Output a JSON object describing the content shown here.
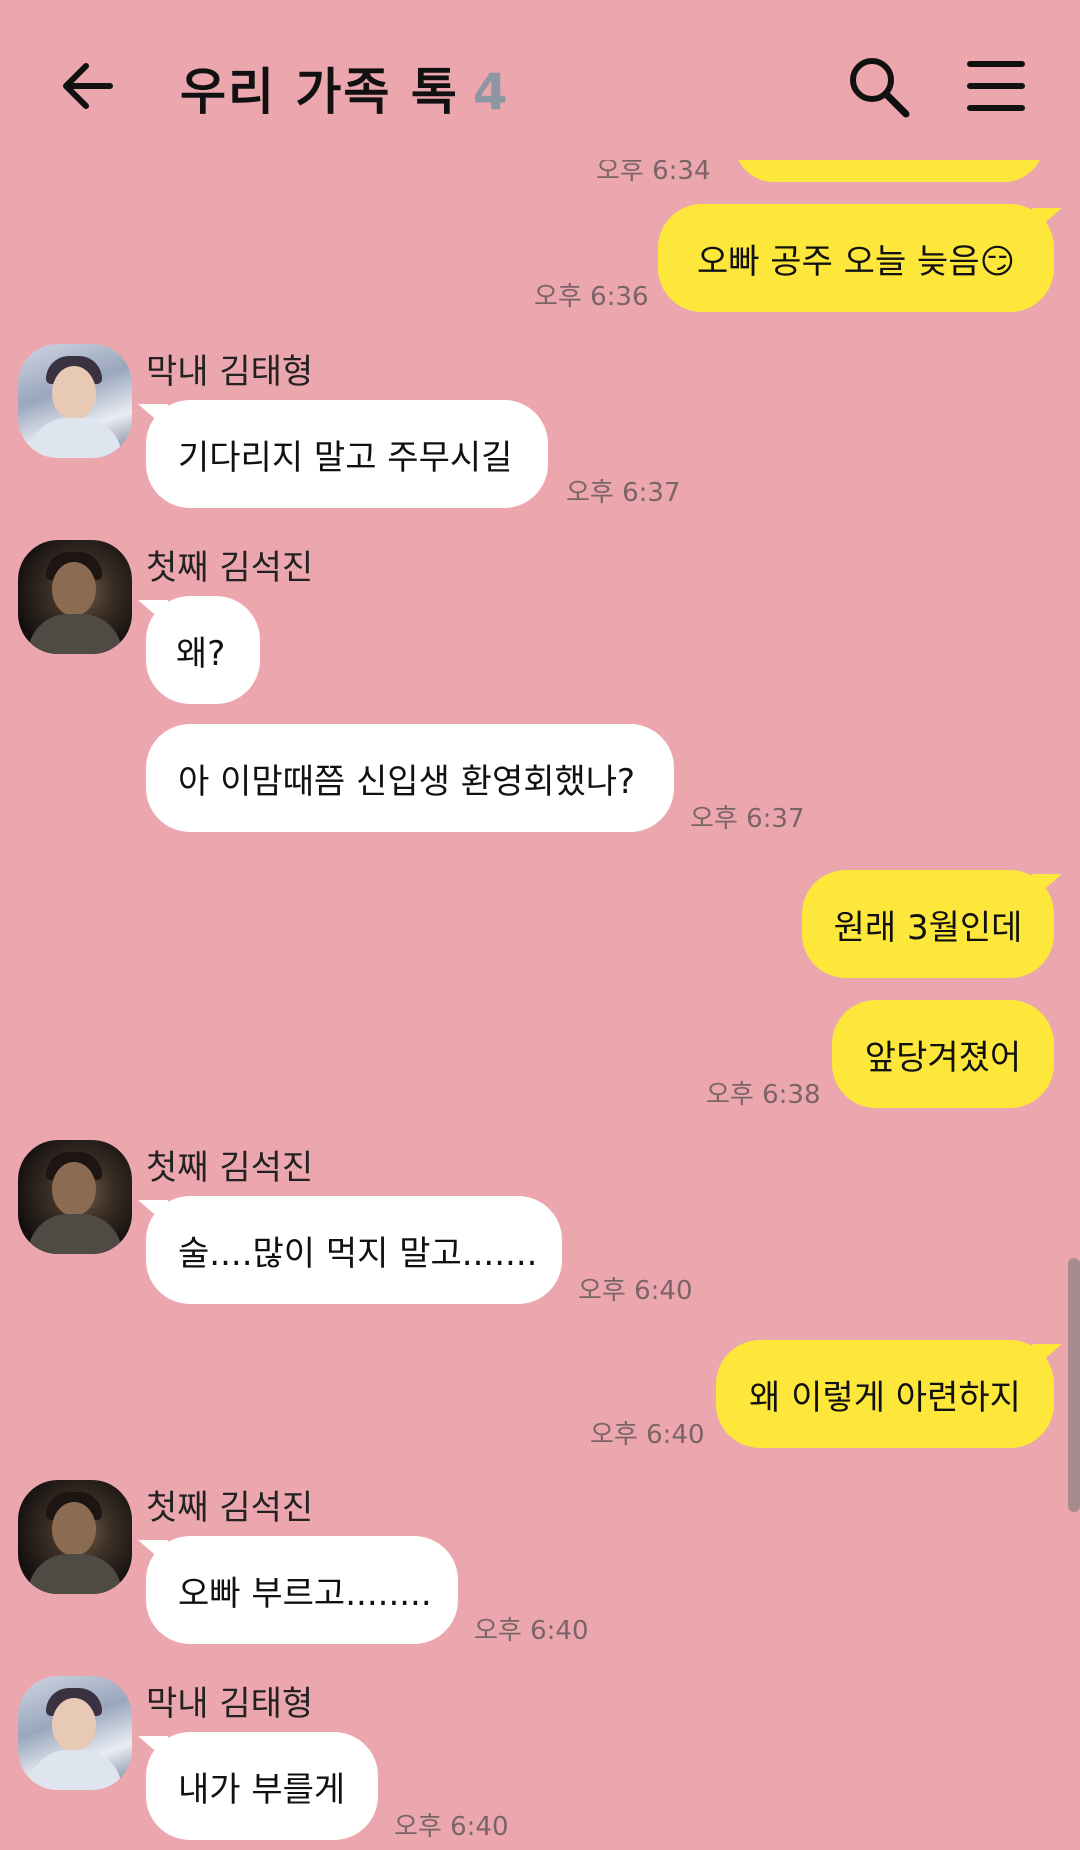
{
  "header": {
    "title": "우리 가족 톡",
    "member_count": "4"
  },
  "icons": {
    "back": "arrow-left-icon",
    "search": "search-icon",
    "menu": "hamburger-menu-icon"
  },
  "colors": {
    "background": "#eca7ae",
    "my_bubble": "#fde73a",
    "their_bubble": "#ffffff",
    "count_gray": "#8d96a3"
  },
  "partial_top": {
    "time": "오후 6:34"
  },
  "messages": [
    {
      "sender": "me",
      "text": "오빠 공주 오늘 늦음😏",
      "time": "오후 6:36"
    },
    {
      "sender": "막내 김태형",
      "text": "기다리지 말고 주무시길",
      "time": "오후 6:37"
    },
    {
      "sender": "첫째 김석진",
      "text": "왜?"
    },
    {
      "sender": "첫째 김석진",
      "text": "아 이맘때쯤 신입생 환영회했나?",
      "time": "오후 6:37"
    },
    {
      "sender": "me",
      "text": "원래 3월인데"
    },
    {
      "sender": "me",
      "text": "앞당겨졌어",
      "time": "오후 6:38"
    },
    {
      "sender": "첫째 김석진",
      "text": "술....많이 먹지 말고.......",
      "time": "오후 6:40"
    },
    {
      "sender": "me",
      "text": "왜 이렇게 아련하지",
      "time": "오후 6:40"
    },
    {
      "sender": "첫째 김석진",
      "text": "오빠 부르고........",
      "time": "오후 6:40"
    },
    {
      "sender": "막내 김태형",
      "text": "내가 부를게",
      "time": "오후 6:40"
    }
  ]
}
